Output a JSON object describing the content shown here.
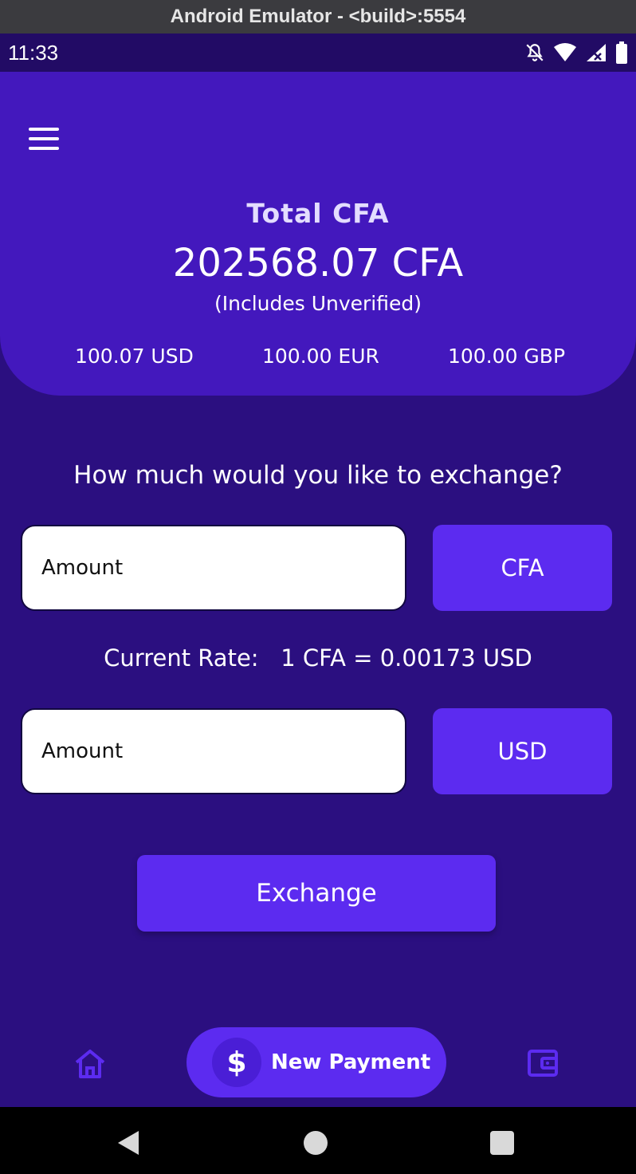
{
  "window": {
    "title": "Android Emulator - <build>:5554"
  },
  "status_bar": {
    "time": "11:33",
    "icons": [
      "bell-off-icon",
      "wifi-icon",
      "signal-icon",
      "battery-icon"
    ]
  },
  "header": {
    "total_label": "Total  CFA",
    "total_amount": "202568.07 CFA",
    "includes_note": "(Includes Unverified)",
    "balances": [
      "100.07 USD",
      "100.00 EUR",
      "100.00 GBP"
    ]
  },
  "exchange": {
    "question": "How much would you like to exchange?",
    "from_placeholder": "Amount",
    "from_currency": "CFA",
    "rate_label": "Current Rate:",
    "rate_value": "1 CFA = 0.00173 USD",
    "to_placeholder": "Amount",
    "to_currency": "USD",
    "exchange_button": "Exchange"
  },
  "bottom_nav": {
    "new_payment_label": "New Payment",
    "dollar_symbol": "$"
  },
  "colors": {
    "background": "#2b0f80",
    "header": "#4318bd",
    "accent": "#5c2bf0",
    "status_bar": "#220b65"
  }
}
